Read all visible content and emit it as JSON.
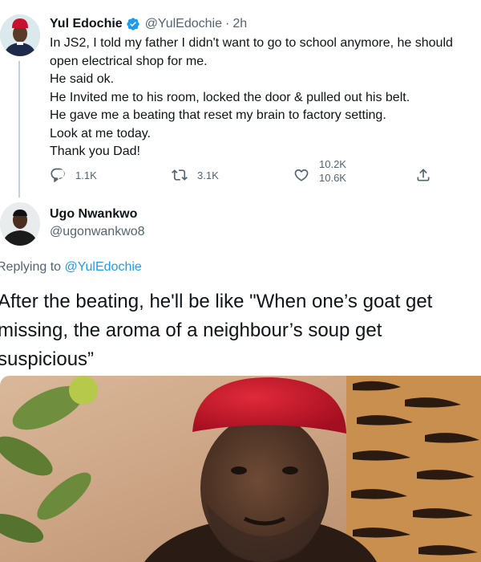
{
  "parent_tweet": {
    "author_name": "Yul Edochie",
    "handle": "@YulEdochie",
    "separator": "·",
    "time": "2h",
    "lines": [
      "In JS2, I told my father I didn't want to go to school anymore, he should",
      "open electrical shop for me.",
      "He said ok.",
      "He Invited me to his room, locked the door & pulled out his belt.",
      "He gave me a beating that reset my brain to factory setting.",
      "Look at me today.",
      "Thank you Dad!"
    ],
    "actions": {
      "reply_count": "1.1K",
      "retweet_count": "3.1K",
      "like_count_old": "10.2K",
      "like_count_new": "10.6K"
    }
  },
  "reply_tweet": {
    "author_name": "Ugo Nwankwo",
    "handle": "@ugonwankwo8",
    "replying_prefix": "Replying to ",
    "replying_to": "@YulEdochie",
    "lines": [
      "After the beating, he'll be like \"When one’s goat get",
      "missing, the aroma of a neighbour’s soup get",
      "suspicious”"
    ]
  },
  "icons": {
    "verified": "verified-badge-icon",
    "reply": "reply-icon",
    "retweet": "retweet-icon",
    "like": "heart-icon",
    "share": "share-icon"
  },
  "colors": {
    "accent": "#1d9bf0",
    "secondary_text": "#536471",
    "primary_text": "#0f1419",
    "thread_line": "#c4cfd6",
    "cap_red": "#c8102e"
  }
}
